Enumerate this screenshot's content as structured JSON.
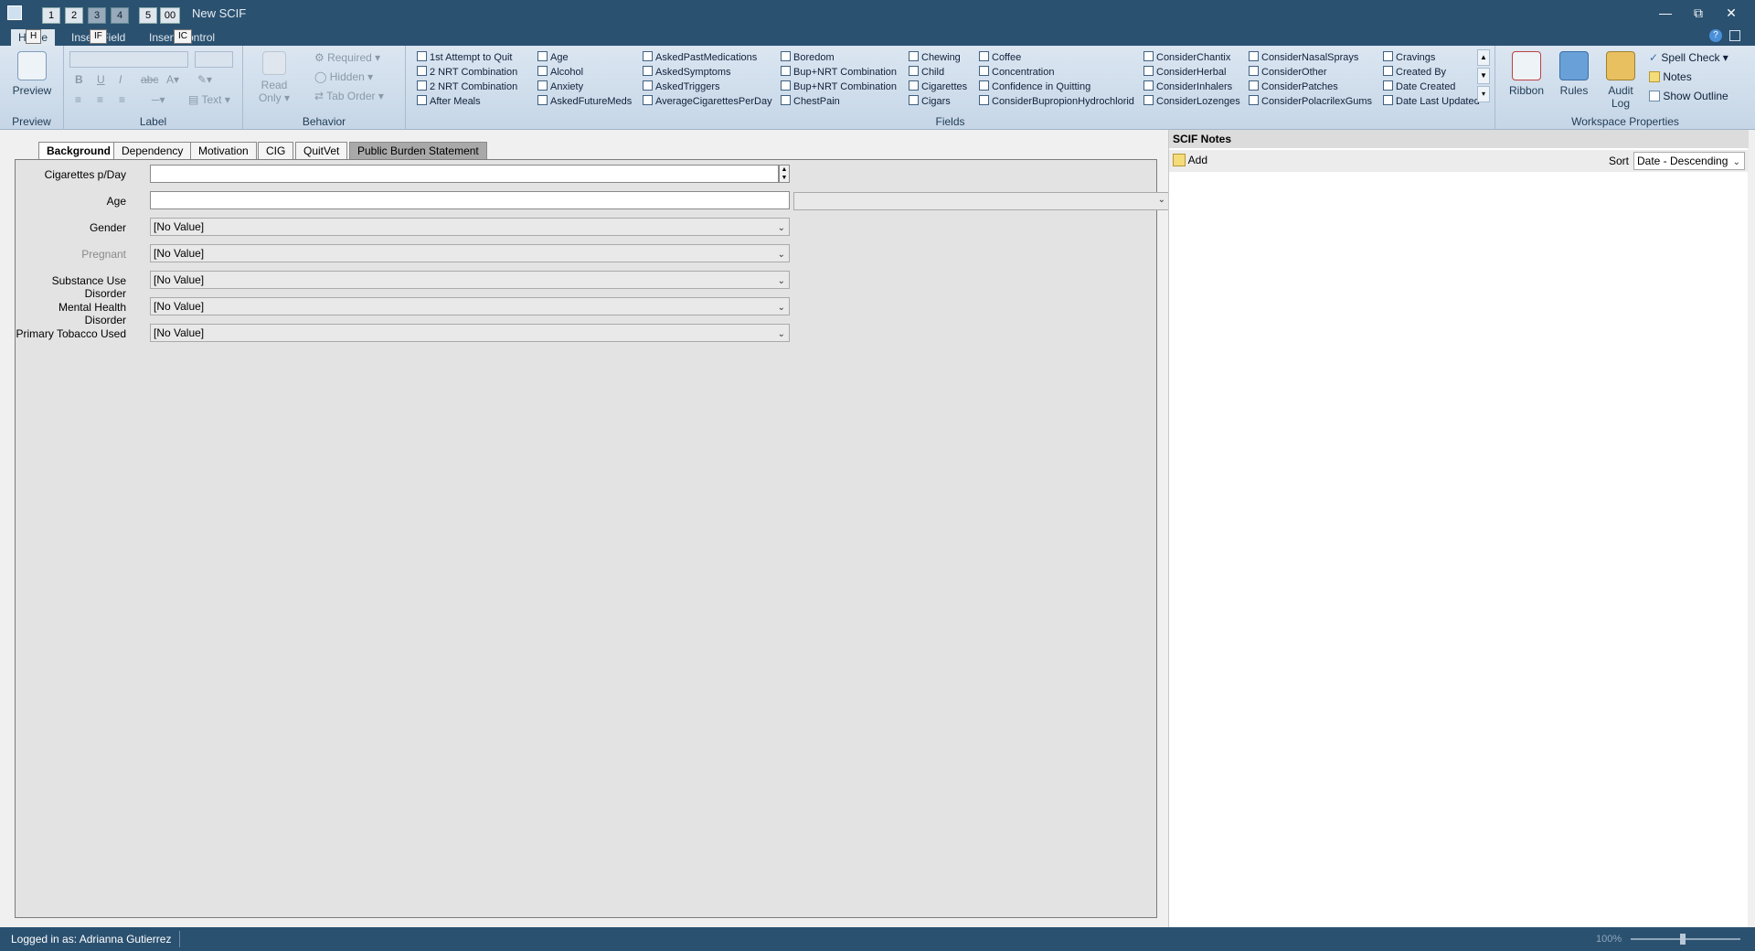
{
  "window": {
    "title": "New SCIF",
    "qat_keytips": [
      "1",
      "2",
      "3",
      "4",
      "5",
      "00"
    ]
  },
  "ribbon_tabs": [
    {
      "label": "Home",
      "keytip": "H"
    },
    {
      "label": "Insert Field",
      "keytip": "IF"
    },
    {
      "label": "Insert Control",
      "keytip": "IC"
    }
  ],
  "ribbon": {
    "preview": {
      "button": "Preview",
      "group": "Preview"
    },
    "label_group": {
      "group": "Label",
      "text_button": "Text"
    },
    "behavior": {
      "group": "Behavior",
      "read_only": "Read Only",
      "required": "Required",
      "hidden": "Hidden",
      "tab_order": "Tab Order"
    },
    "fields_group": "Fields",
    "fields_columns": [
      [
        "1st Attempt to Quit",
        "2 NRT Combination",
        "2 NRT Combination",
        "After Meals"
      ],
      [
        "Age",
        "Alcohol",
        "Anxiety",
        "AskedFutureMeds"
      ],
      [
        "AskedPastMedications",
        "AskedSymptoms",
        "AskedTriggers",
        "AverageCigarettesPerDay"
      ],
      [
        "Boredom",
        "Bup+NRT Combination",
        "Bup+NRT Combination",
        "ChestPain"
      ],
      [
        "Chewing",
        "Child",
        "Cigarettes",
        "Cigars"
      ],
      [
        "Coffee",
        "Concentration",
        "Confidence in Quitting",
        "ConsiderBupropionHydrochlorid"
      ],
      [
        "ConsiderChantix",
        "ConsiderHerbal",
        "ConsiderInhalers",
        "ConsiderLozenges"
      ],
      [
        "ConsiderNasalSprays",
        "ConsiderOther",
        "ConsiderPatches",
        "ConsiderPolacrilexGums"
      ],
      [
        "Cravings",
        "Created By",
        "Date Created",
        "Date Last Updated"
      ]
    ],
    "workspace": {
      "group": "Workspace Properties",
      "ribbon": "Ribbon",
      "rules": "Rules",
      "audit_log": "Audit Log",
      "spell_check": "Spell Check",
      "notes": "Notes",
      "show_outline": "Show Outline"
    }
  },
  "form_tabs": [
    "Background",
    "Dependency",
    "Motivation",
    "CIG",
    "QuitVet",
    "Public Burden Statement"
  ],
  "form_fields": [
    {
      "label": "Cigarettes p/Day",
      "value": ""
    },
    {
      "label": "Age",
      "value": ""
    },
    {
      "label": "Gender",
      "value": "[No Value]"
    },
    {
      "label": "Pregnant",
      "value": "[No Value]"
    },
    {
      "label": "Substance Use Disorder",
      "value": "[No Value]"
    },
    {
      "label": "Mental Health Disorder",
      "value": "[No Value]"
    },
    {
      "label": "Primary Tobacco Used",
      "value": "[No Value]"
    }
  ],
  "notes_panel": {
    "title": "SCIF Notes",
    "add": "Add",
    "sort_label": "Sort",
    "sort_value": "Date - Descending"
  },
  "status": {
    "logged_in": "Logged in as: Adrianna Gutierrez",
    "zoom": "100%"
  }
}
